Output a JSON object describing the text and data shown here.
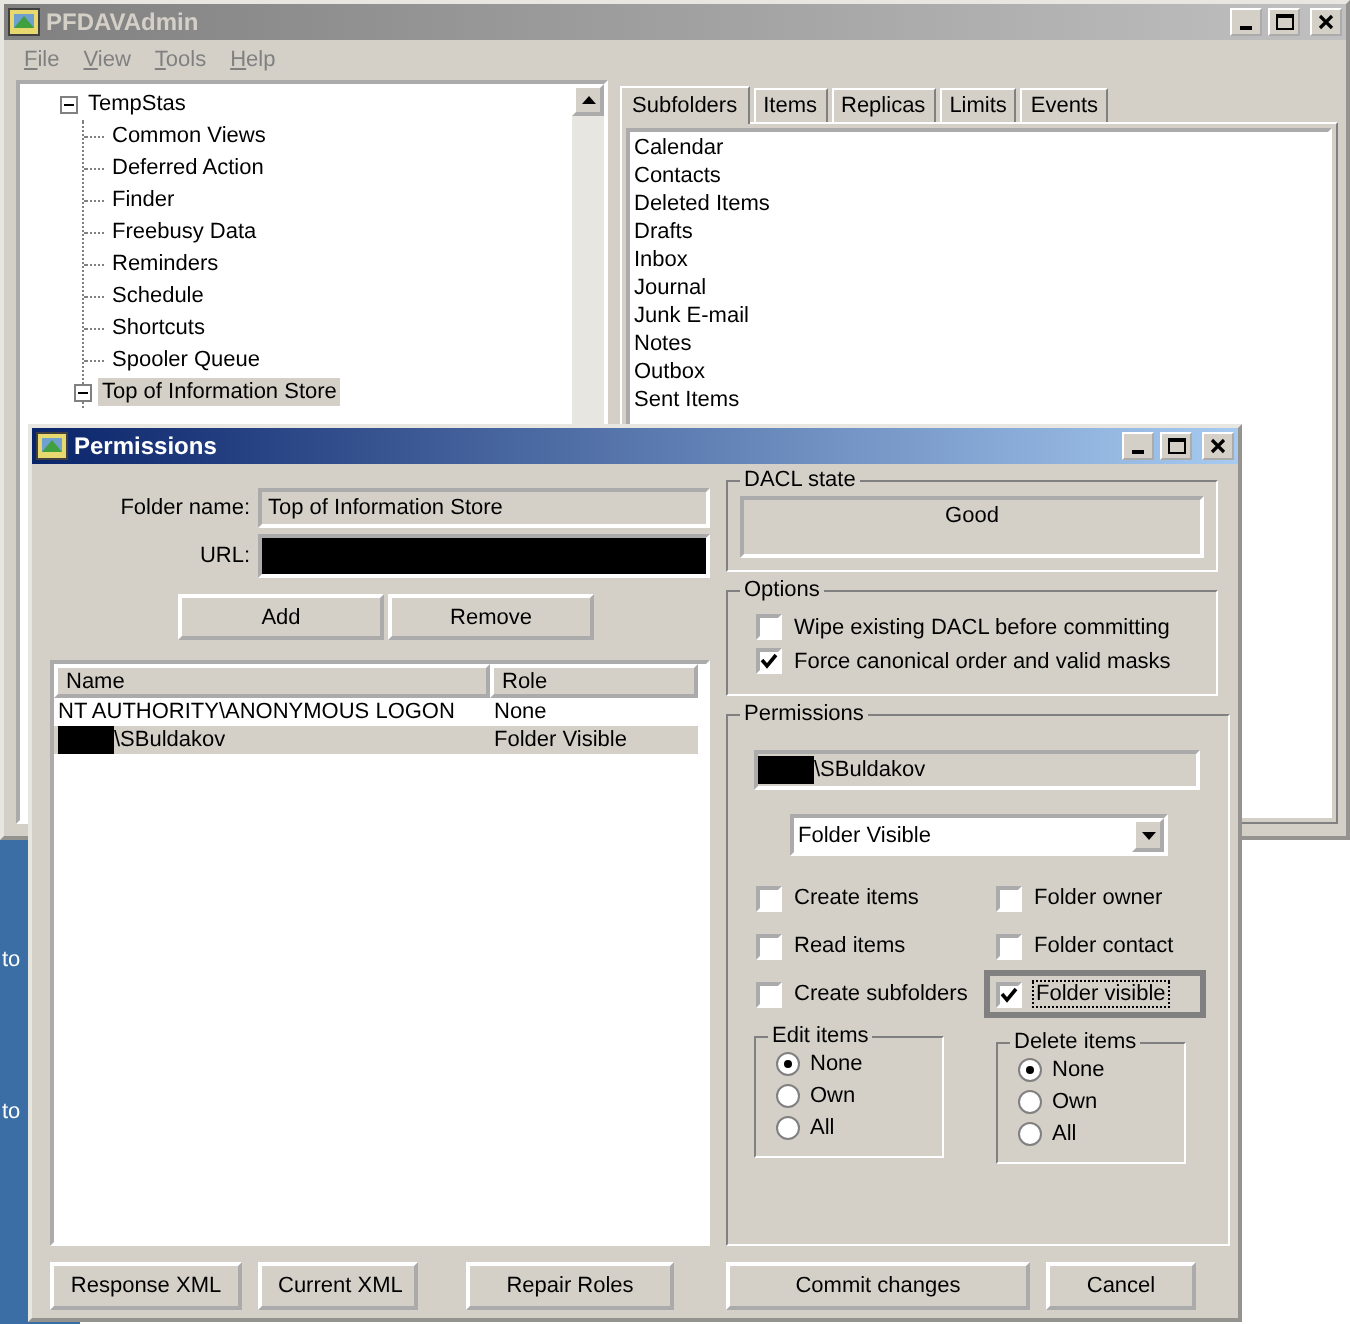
{
  "desktop": {
    "labels": [
      "to",
      "to"
    ]
  },
  "main_window": {
    "title": "PFDAVAdmin",
    "active": false,
    "menu": [
      "File",
      "View",
      "Tools",
      "Help"
    ],
    "tree": [
      {
        "label": "TempStas",
        "expanded": true,
        "selected": false,
        "children": [
          {
            "label": "Common Views",
            "selected": false
          },
          {
            "label": "Deferred Action",
            "selected": false
          },
          {
            "label": "Finder",
            "selected": false
          },
          {
            "label": "Freebusy Data",
            "selected": false
          },
          {
            "label": "Reminders",
            "selected": false
          },
          {
            "label": "Schedule",
            "selected": false
          },
          {
            "label": "Shortcuts",
            "selected": false
          },
          {
            "label": "Spooler Queue",
            "selected": false
          },
          {
            "label": "Top of Information Store",
            "expanded": true,
            "selected": true
          }
        ]
      }
    ],
    "tabs": [
      {
        "label": "Subfolders",
        "selected": true
      },
      {
        "label": "Items",
        "selected": false
      },
      {
        "label": "Replicas",
        "selected": false
      },
      {
        "label": "Limits",
        "selected": false
      },
      {
        "label": "Events",
        "selected": false
      }
    ],
    "subfolders": [
      "Calendar",
      "Contacts",
      "Deleted Items",
      "Drafts",
      "Inbox",
      "Journal",
      "Junk E-mail",
      "Notes",
      "Outbox",
      "Sent Items"
    ]
  },
  "dialog": {
    "title": "Permissions",
    "active": true,
    "folder_name_label": "Folder name:",
    "folder_name": "Top of Information Store",
    "url_label": "URL:",
    "url_redacted": true,
    "top_buttons": [
      "Add",
      "Remove"
    ],
    "list": {
      "columns": [
        "Name",
        "Role"
      ],
      "rows": [
        {
          "name": "NT AUTHORITY\\ANONYMOUS LOGON",
          "role": "None",
          "redacted": false,
          "selected": false
        },
        {
          "name": "\\SBuldakov",
          "role": "Folder Visible",
          "redacted": true,
          "selected": true
        }
      ]
    },
    "dacl_state": {
      "label": "DACL state",
      "value": "Good"
    },
    "options": {
      "label": "Options",
      "items": [
        {
          "label": "Wipe existing DACL before committing",
          "checked": false
        },
        {
          "label": "Force canonical order and valid masks",
          "checked": true
        }
      ]
    },
    "permissions": {
      "label": "Permissions",
      "user": "\\SBuldakov",
      "user_redacted": true,
      "role": "Folder Visible",
      "checkboxes": [
        {
          "label": "Create items",
          "checked": false,
          "focused": false
        },
        {
          "label": "Folder owner",
          "checked": false,
          "focused": false
        },
        {
          "label": "Read items",
          "checked": false,
          "focused": false
        },
        {
          "label": "Folder contact",
          "checked": false,
          "focused": false
        },
        {
          "label": "Create subfolders",
          "checked": false,
          "focused": false
        },
        {
          "label": "Folder visible",
          "checked": true,
          "focused": true
        }
      ],
      "edit_items": {
        "label": "Edit items",
        "options": [
          {
            "label": "None",
            "selected": true
          },
          {
            "label": "Own",
            "selected": false
          },
          {
            "label": "All",
            "selected": false
          }
        ]
      },
      "delete_items": {
        "label": "Delete items",
        "options": [
          {
            "label": "None",
            "selected": true
          },
          {
            "label": "Own",
            "selected": false
          },
          {
            "label": "All",
            "selected": false
          }
        ]
      }
    },
    "left_buttons": [
      "Response XML",
      "Current XML",
      "Repair Roles"
    ],
    "right_buttons": [
      "Commit changes",
      "Cancel"
    ]
  }
}
